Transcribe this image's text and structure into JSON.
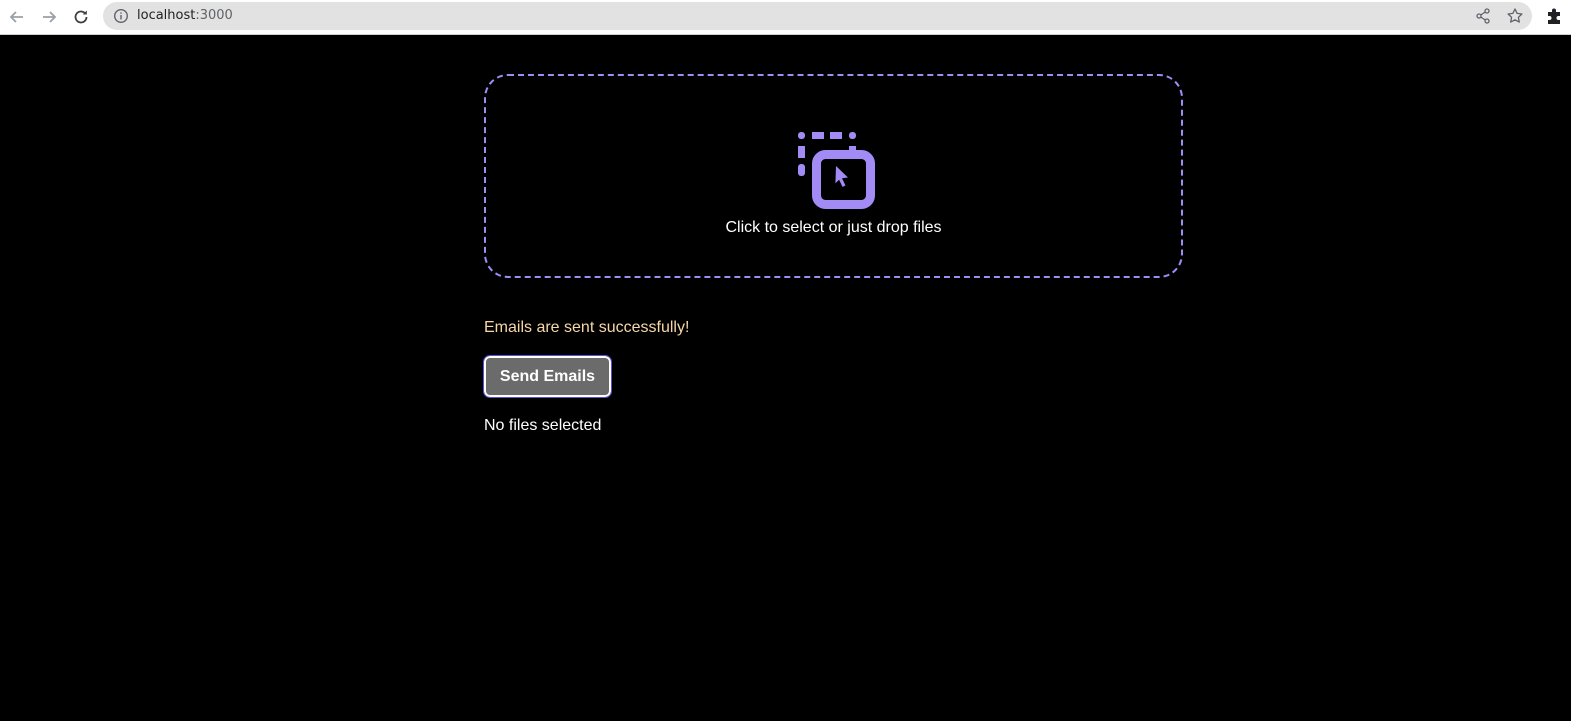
{
  "browser": {
    "url_host": "localhost",
    "url_port": ":3000",
    "icons": {
      "back": "arrow-left-icon",
      "forward": "arrow-right-icon",
      "reload": "reload-icon",
      "info": "info-icon",
      "share": "share-icon",
      "bookmark": "star-icon",
      "extensions": "puzzle-icon"
    }
  },
  "dropzone": {
    "label": "Click to select or just drop files",
    "icon": "select-window-cursor-icon",
    "accent_color": "#a28bf5"
  },
  "status": {
    "message": "Emails are sent successfully!",
    "color": "#f7d7a8"
  },
  "actions": {
    "send_label": "Send Emails"
  },
  "files": {
    "status_text": "No files selected"
  },
  "colors": {
    "background": "#000000",
    "button_bg": "#6b6b6b"
  }
}
